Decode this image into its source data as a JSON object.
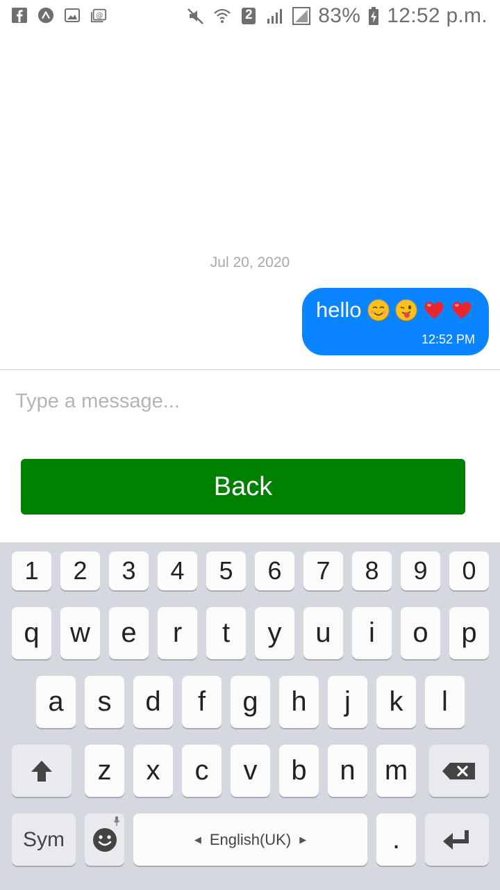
{
  "status_bar": {
    "left_icons": [
      "facebook-icon",
      "app-badge-icon",
      "gallery-icon",
      "email-icon"
    ],
    "battery": "83%",
    "time": "12:52 p.m.",
    "sim_slot": "2"
  },
  "chat": {
    "date": "Jul 20, 2020",
    "messages": [
      {
        "text": "hello",
        "emojis": [
          "smiling-face",
          "winking-face-tongue",
          "red-heart",
          "red-heart"
        ],
        "time": "12:52 PM",
        "bubble_color": "#0a84ff"
      }
    ]
  },
  "composer": {
    "placeholder": "Type a message...",
    "value": ""
  },
  "back_button": {
    "label": "Back",
    "color": "#008000"
  },
  "keyboard": {
    "numbers": [
      "1",
      "2",
      "3",
      "4",
      "5",
      "6",
      "7",
      "8",
      "9",
      "0"
    ],
    "row1": [
      "q",
      "w",
      "e",
      "r",
      "t",
      "y",
      "u",
      "i",
      "o",
      "p"
    ],
    "row2": [
      "a",
      "s",
      "d",
      "f",
      "g",
      "h",
      "j",
      "k",
      "l"
    ],
    "row3": [
      "z",
      "x",
      "c",
      "v",
      "b",
      "n",
      "m"
    ],
    "sym": "Sym",
    "language": "English(UK)",
    "period": "."
  }
}
